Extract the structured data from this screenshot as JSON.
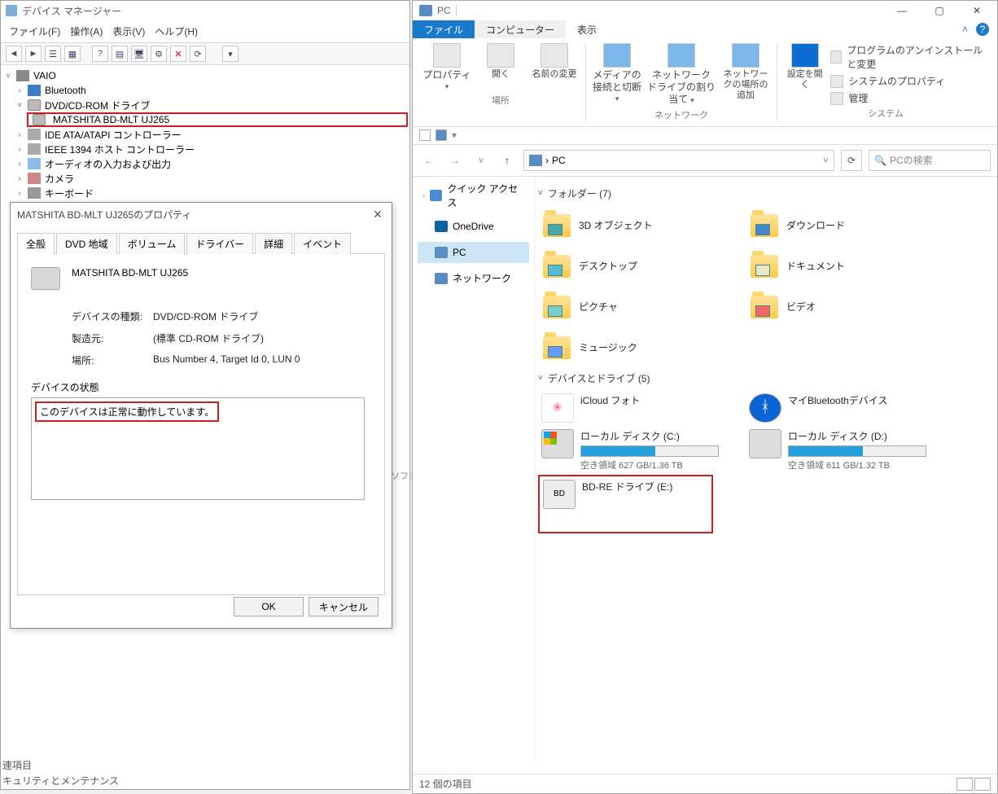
{
  "device_manager": {
    "title": "デバイス マネージャー",
    "menu": [
      "ファイル(F)",
      "操作(A)",
      "表示(V)",
      "ヘルプ(H)"
    ],
    "tree": {
      "root": "VAIO",
      "items": [
        {
          "label": "Bluetooth",
          "icon": "bt",
          "expand": ">"
        },
        {
          "label": "DVD/CD-ROM ドライブ",
          "icon": "disc",
          "expand": "v",
          "children": [
            {
              "label": "MATSHITA BD-MLT UJ265",
              "icon": "disc",
              "boxed": true
            }
          ]
        },
        {
          "label": "IDE ATA/ATAPI コントローラー",
          "icon": "hdd",
          "expand": ">"
        },
        {
          "label": "IEEE 1394 ホスト コントローラー",
          "icon": "hdd",
          "expand": ">"
        },
        {
          "label": "オーディオの入力および出力",
          "icon": "snd",
          "expand": ">"
        },
        {
          "label": "カメラ",
          "icon": "cam",
          "expand": ">"
        },
        {
          "label": "キーボード",
          "icon": "kb",
          "expand": ">"
        }
      ]
    },
    "footer_lines": [
      "連項目",
      "キュリティとメンテナンス"
    ]
  },
  "properties": {
    "title": "MATSHITA BD-MLT UJ265のプロパティ",
    "tabs": [
      "全般",
      "DVD 地域",
      "ボリューム",
      "ドライバー",
      "詳細",
      "イベント"
    ],
    "active_tab": 0,
    "device_name": "MATSHITA BD-MLT UJ265",
    "rows": [
      {
        "label": "デバイスの種類:",
        "value": "DVD/CD-ROM ドライブ"
      },
      {
        "label": "製造元:",
        "value": "(標準 CD-ROM ドライブ)"
      },
      {
        "label": "場所:",
        "value": "Bus Number 4, Target Id 0, LUN 0"
      }
    ],
    "status_label": "デバイスの状態",
    "status_text": "このデバイスは正常に動作しています。",
    "buttons": {
      "ok": "OK",
      "cancel": "キャンセル"
    }
  },
  "explorer": {
    "title": "PC",
    "tabs": {
      "file": "ファイル",
      "computer": "コンピューター",
      "view": "表示"
    },
    "ribbon": {
      "g1": {
        "title": "場所",
        "items": [
          {
            "label": "プロパティ",
            "drop": true
          },
          {
            "label": "開く"
          },
          {
            "label": "名前の変更"
          }
        ]
      },
      "g2": {
        "title": "ネットワーク",
        "items": [
          {
            "label": "メディアの接続と切断",
            "drop": true
          },
          {
            "label": "ネットワーク ドライブの割り当て",
            "drop": true
          },
          {
            "label": "ネットワークの場所の追加"
          }
        ]
      },
      "g3": {
        "title": "システム",
        "items": [
          {
            "label": "設定を開く"
          }
        ],
        "small": [
          {
            "label": "プログラムのアンインストールと変更"
          },
          {
            "label": "システムのプロパティ"
          },
          {
            "label": "管理"
          }
        ]
      }
    },
    "address": {
      "crumb": "PC",
      "sep": "›",
      "search_placeholder": "PCの検索"
    },
    "sidebar": [
      {
        "label": "クイック アクセス",
        "icon": "star"
      },
      {
        "label": "OneDrive",
        "icon": "od"
      },
      {
        "label": "PC",
        "icon": "pc",
        "selected": true
      },
      {
        "label": "ネットワーク",
        "icon": "net"
      }
    ],
    "folders_header": "フォルダー (7)",
    "folders": [
      {
        "label": "3D オブジェクト"
      },
      {
        "label": "ダウンロード"
      },
      {
        "label": "デスクトップ"
      },
      {
        "label": "ドキュメント"
      },
      {
        "label": "ピクチャ"
      },
      {
        "label": "ビデオ"
      },
      {
        "label": "ミュージック"
      }
    ],
    "drives_header": "デバイスとドライブ (5)",
    "drives": [
      {
        "label": "iCloud フォト",
        "type": "app"
      },
      {
        "label": "マイBluetoothデバイス",
        "type": "bt"
      },
      {
        "label": "ローカル ディスク (C:)",
        "type": "win",
        "sub": "空き領域 627 GB/1.36 TB",
        "fill": 54
      },
      {
        "label": "ローカル ディスク (D:)",
        "type": "hdd",
        "sub": "空き領域 611 GB/1.32 TB",
        "fill": 54
      },
      {
        "label": "BD-RE ドライブ (E:)",
        "type": "disc",
        "boxed": true
      }
    ],
    "status": "12 個の項目"
  },
  "misc": {
    "soft_text": "ソフトウ"
  }
}
